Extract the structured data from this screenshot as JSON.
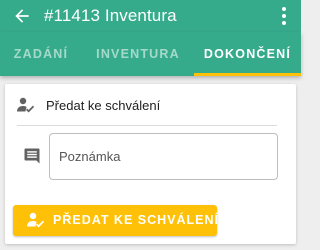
{
  "appbar": {
    "title": "#11413 Inventura",
    "color": "#36ab8c",
    "back_icon": "arrow-back-icon",
    "menu_icon": "more-vert-icon"
  },
  "tabs": [
    {
      "label": "ZADÁNÍ",
      "active": false
    },
    {
      "label": "INVENTURA",
      "active": false
    },
    {
      "label": "DOKONČENÍ",
      "active": true
    }
  ],
  "tab_indicator_color": "#ffc107",
  "card": {
    "header_icon": "person-check-icon",
    "title": "Předat ke schválení",
    "note": {
      "icon": "comment-icon",
      "placeholder": "Poznámka",
      "value": ""
    },
    "submit": {
      "icon": "person-check-icon",
      "label": "PŘEDAT KE SCHVÁLENÍ",
      "color": "#ffc107"
    }
  }
}
